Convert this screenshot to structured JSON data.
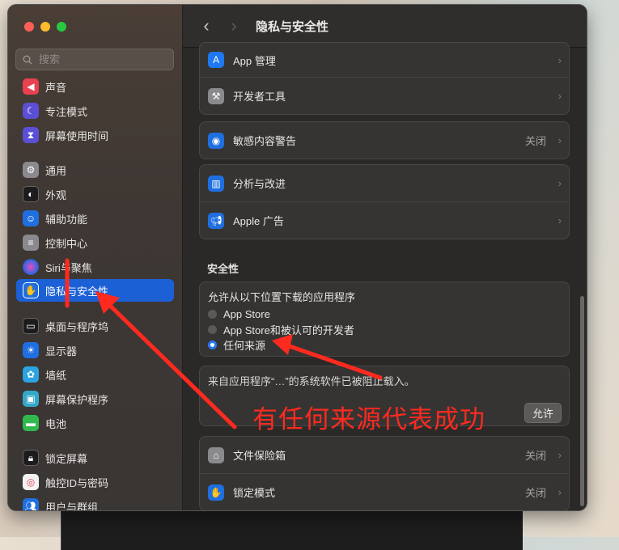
{
  "window": {
    "title": "隐私与安全性"
  },
  "search": {
    "placeholder": "搜索"
  },
  "sidebar": {
    "items": [
      {
        "label": "声音",
        "icon": "speaker-icon",
        "color": "#e8414f"
      },
      {
        "label": "专注模式",
        "icon": "moon-icon",
        "color": "#5b4fd6"
      },
      {
        "label": "屏幕使用时间",
        "icon": "hourglass-icon",
        "color": "#5b4fd6"
      },
      {
        "label": "通用",
        "icon": "gear-icon",
        "color": "#8a8a8e"
      },
      {
        "label": "外观",
        "icon": "appearance-icon",
        "color": "#1c1c1e"
      },
      {
        "label": "辅助功能",
        "icon": "accessibility-icon",
        "color": "#1f6fe0"
      },
      {
        "label": "控制中心",
        "icon": "control-center-icon",
        "color": "#8a8a8e"
      },
      {
        "label": "Siri与聚焦",
        "icon": "siri-icon",
        "color": "#6a3cc4"
      },
      {
        "label": "隐私与安全性",
        "icon": "hand-icon",
        "color": "#1f6fe0"
      },
      {
        "label": "桌面与程序坞",
        "icon": "dock-icon",
        "color": "#1c1c1e"
      },
      {
        "label": "显示器",
        "icon": "sun-icon",
        "color": "#1f6fe0"
      },
      {
        "label": "墙纸",
        "icon": "flower-icon",
        "color": "#2aa3e0"
      },
      {
        "label": "屏幕保护程序",
        "icon": "screensaver-icon",
        "color": "#34a8c9"
      },
      {
        "label": "电池",
        "icon": "battery-icon",
        "color": "#31b94d"
      },
      {
        "label": "锁定屏幕",
        "icon": "lock-icon",
        "color": "#1c1c1e"
      },
      {
        "label": "触控ID与密码",
        "icon": "fingerprint-icon",
        "color": "#e8414f"
      },
      {
        "label": "用户与群组",
        "icon": "users-icon",
        "color": "#1f6fe0"
      }
    ]
  },
  "content": {
    "group1": [
      {
        "label": "App 管理",
        "icon": "app-store-icon",
        "color": "#1f78f0"
      },
      {
        "label": "开发者工具",
        "icon": "hammer-icon",
        "color": "#8a8a8e"
      }
    ],
    "group2": [
      {
        "label": "敏感内容警告",
        "icon": "eye-icon",
        "color": "#1f6fe0",
        "value": "关闭"
      }
    ],
    "group3": [
      {
        "label": "分析与改进",
        "icon": "chart-icon",
        "color": "#1f6fe0"
      },
      {
        "label": "Apple 广告",
        "icon": "megaphone-icon",
        "color": "#1f6fe0"
      }
    ],
    "security": {
      "section_label": "安全性",
      "download_prompt": "允许从以下位置下载的应用程序",
      "options": [
        "App Store",
        "App Store和被认可的开发者",
        "任何来源"
      ],
      "selected": "任何来源",
      "blocked_text": "来自应用程序“…”的系统软件已被阻止载入。",
      "allow_button": "允许"
    },
    "group5": [
      {
        "label": "文件保险箱",
        "icon": "vault-icon",
        "color": "#8a8a8e",
        "value": "关闭"
      },
      {
        "label": "锁定模式",
        "icon": "hand-icon",
        "color": "#1f6fe0",
        "value": "关闭"
      }
    ]
  },
  "annotation": {
    "text": "有任何来源代表成功",
    "color": "#ff2a1f"
  }
}
